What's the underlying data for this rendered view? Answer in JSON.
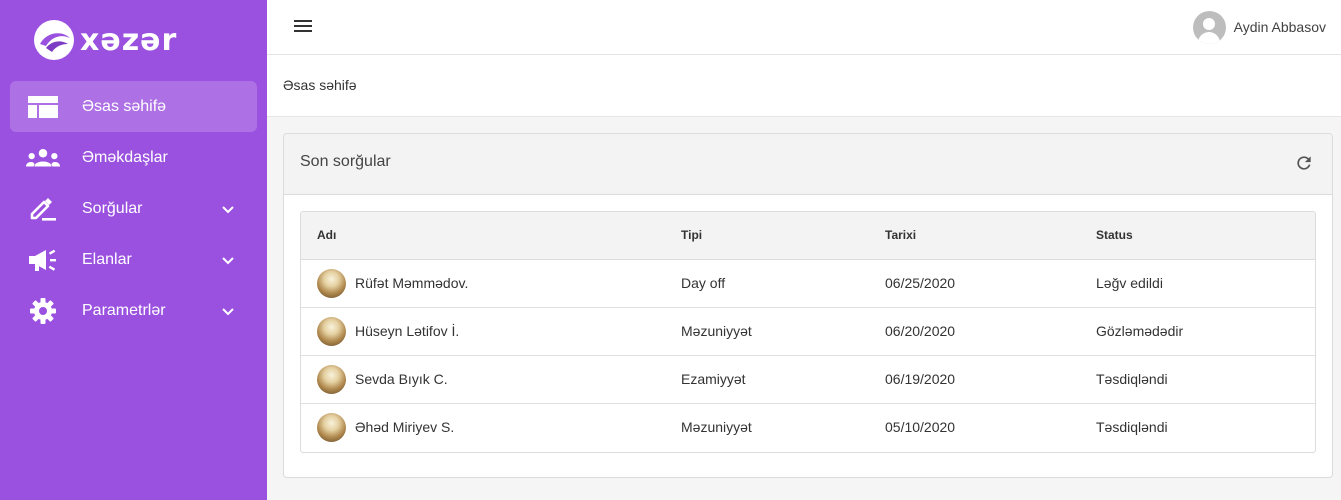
{
  "brand": {
    "name": "xəzər"
  },
  "sidebar": {
    "items": [
      {
        "label": "Əsas səhifə",
        "icon": "dashboard-icon",
        "active": true,
        "expandable": false
      },
      {
        "label": "Əməkdaşlar",
        "icon": "people-icon",
        "active": false,
        "expandable": false
      },
      {
        "label": "Sorğular",
        "icon": "edit-icon",
        "active": false,
        "expandable": true
      },
      {
        "label": "Elanlar",
        "icon": "megaphone-icon",
        "active": false,
        "expandable": true
      },
      {
        "label": "Parametrlər",
        "icon": "gear-icon",
        "active": false,
        "expandable": true
      }
    ]
  },
  "topbar": {
    "user_name": "Aydin Abbasov"
  },
  "breadcrumb": {
    "current": "Əsas səhifə"
  },
  "card": {
    "title": "Son sorğular",
    "table": {
      "headers": [
        "Adı",
        "Tipi",
        "Tarixi",
        "Status"
      ],
      "rows": [
        {
          "name": "Rüfət Məmmədov.",
          "type": "Day off",
          "date": "06/25/2020",
          "status": "Ləğv edildi"
        },
        {
          "name": "Hüseyn Lətifov İ.",
          "type": "Məzuniyyət",
          "date": "06/20/2020",
          "status": "Gözləmədədir"
        },
        {
          "name": "Sevda Bıyık C.",
          "type": "Ezamiyyət",
          "date": "06/19/2020",
          "status": "Təsdiqləndi"
        },
        {
          "name": "Əhəd Miriyev S.",
          "type": "Məzuniyyət",
          "date": "05/10/2020",
          "status": "Təsdiqləndi"
        }
      ]
    }
  },
  "colors": {
    "sidebar_bg": "#9b51e0",
    "active_item_bg": "rgba(255,255,255,0.18)"
  }
}
